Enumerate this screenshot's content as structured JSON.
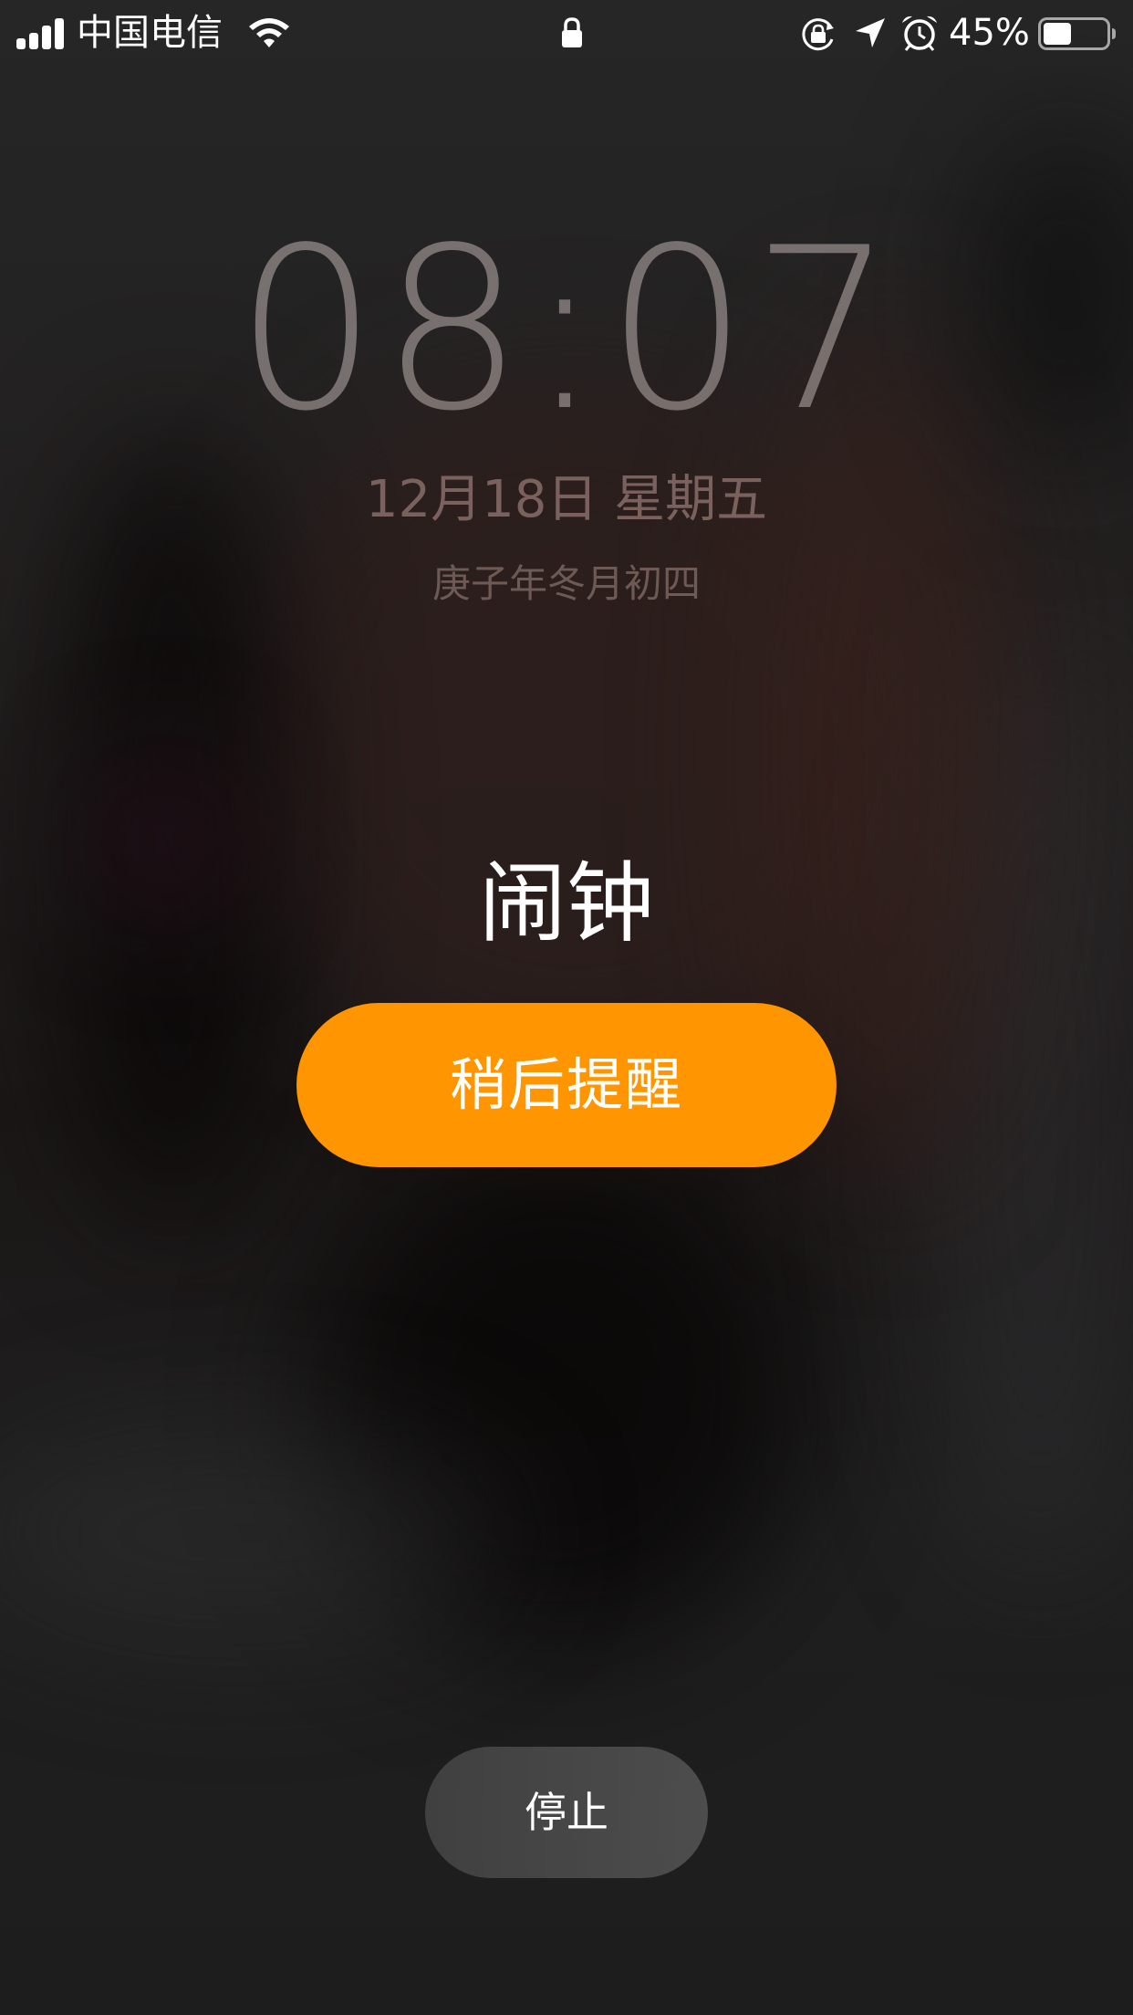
{
  "status_bar": {
    "carrier": "中国电信",
    "battery_percent_text": "45%",
    "battery_level": 0.45,
    "icons": [
      "signal-icon",
      "wifi-icon",
      "lock-icon",
      "rotation-lock-icon",
      "location-icon",
      "alarm-icon",
      "battery-icon"
    ]
  },
  "lock_screen": {
    "time": "08:07",
    "date": "12月18日 星期五",
    "lunar_date": "庚子年冬月初四"
  },
  "alarm": {
    "label": "闹钟",
    "snooze_label": "稍后提醒",
    "stop_label": "停止"
  },
  "colors": {
    "snooze_button": "#ff9500",
    "text_primary": "#ffffff"
  }
}
